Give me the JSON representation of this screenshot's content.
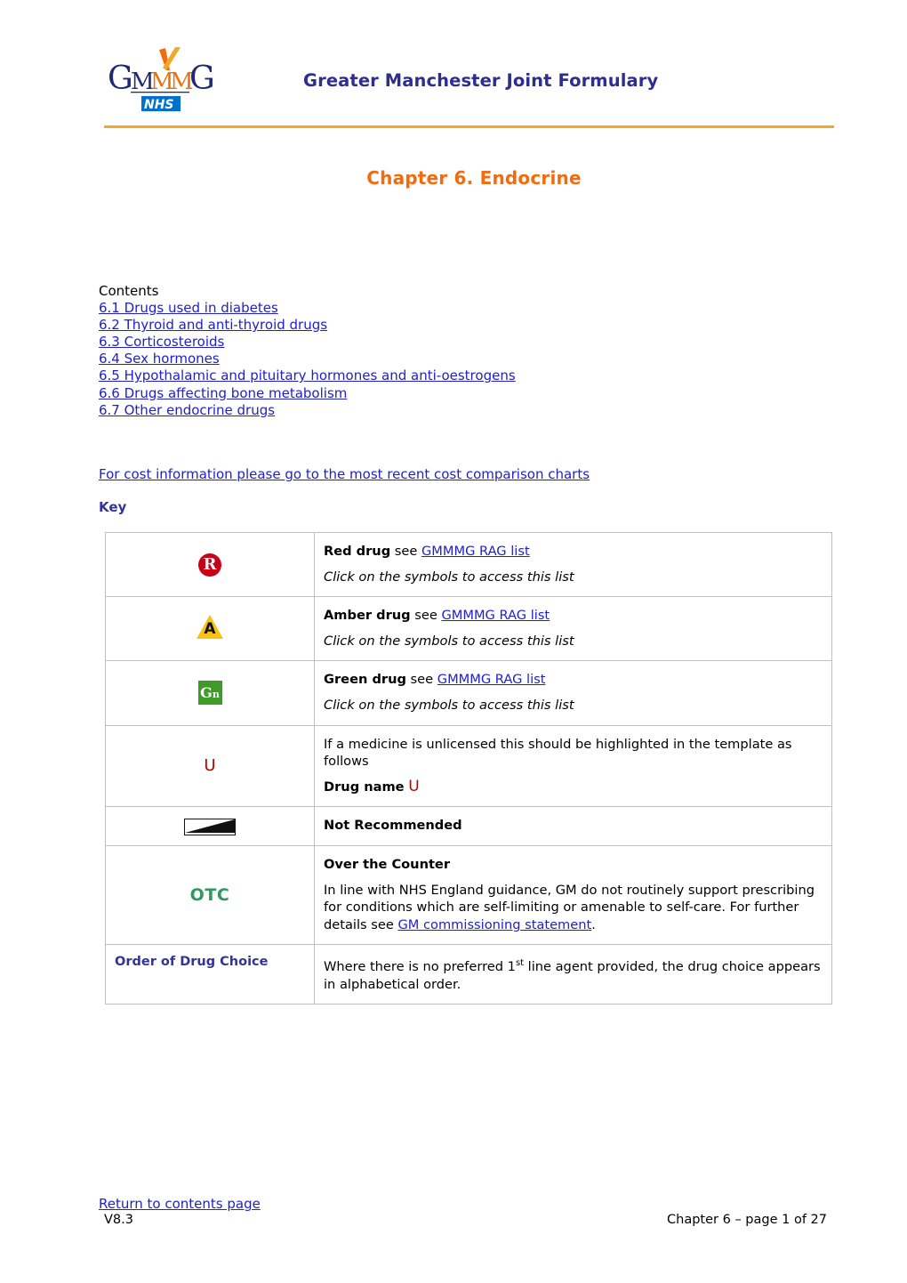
{
  "header": {
    "logo_text": "GMMMG",
    "logo_sub": "NHS",
    "title": "Greater Manchester Joint Formulary"
  },
  "chapter": {
    "title": "Chapter 6. Endocrine"
  },
  "contents": {
    "label": "Contents",
    "items": [
      "6.1 Drugs used in diabetes",
      "6.2 Thyroid and anti-thyroid drugs",
      "6.3 Corticosteroids",
      "6.4 Sex hormones",
      "6.5 Hypothalamic and pituitary hormones and anti-oestrogens",
      "6.6 Drugs affecting bone metabolism",
      "6.7 Other endocrine drugs"
    ]
  },
  "cost_link": "For cost information please go to the most recent cost comparison charts",
  "key": {
    "label": "Key",
    "rows": {
      "red": {
        "icon_letter": "R",
        "title": "Red drug",
        "see": " see ",
        "link": "GMMMG RAG list",
        "note": "Click on the symbols to access this list"
      },
      "amber": {
        "icon_letter": "A",
        "title": "Amber drug",
        "see": " see ",
        "link": "GMMMG RAG list",
        "note": "Click on the symbols to access this list"
      },
      "green": {
        "icon_letter": "G",
        "icon_sub": "n",
        "title": "Green drug",
        "see": " see ",
        "link": "GMMMG RAG list",
        "note": "Click on the symbols to access this list"
      },
      "unlicensed": {
        "icon_letter": "U",
        "text": "If a medicine is unlicensed this should be highlighted in the template as follows",
        "example_label": "Drug name",
        "example_mark": "U"
      },
      "not_recommended": {
        "title": "Not Recommended"
      },
      "otc": {
        "icon_text": "OTC",
        "title": "Over the Counter",
        "body_before": "In line with NHS England guidance, GM do not routinely support prescribing for conditions which are self-limiting or amenable to self-care. For further details see ",
        "link": "GM commissioning statement",
        "body_after": "."
      },
      "order": {
        "label": "Order of Drug Choice",
        "text_before": "Where there is no preferred 1",
        "superscript": "st",
        "text_after": " line agent provided, the drug choice appears in alphabetical order."
      }
    }
  },
  "footer": {
    "return_link": "Return to contents page",
    "version": "V8.3",
    "page_info": "Chapter 6 – page 1 of 27"
  },
  "colors": {
    "brand_navy": "#2E2E8F",
    "brand_orange": "#F26B0F",
    "rule_orange": "#F5A623",
    "link_blue": "#2020D0",
    "red": "#C90016",
    "amber": "#F7C117",
    "green": "#3E9B27",
    "otc_green": "#2E9B5E",
    "key_label_navy": "#333399"
  }
}
